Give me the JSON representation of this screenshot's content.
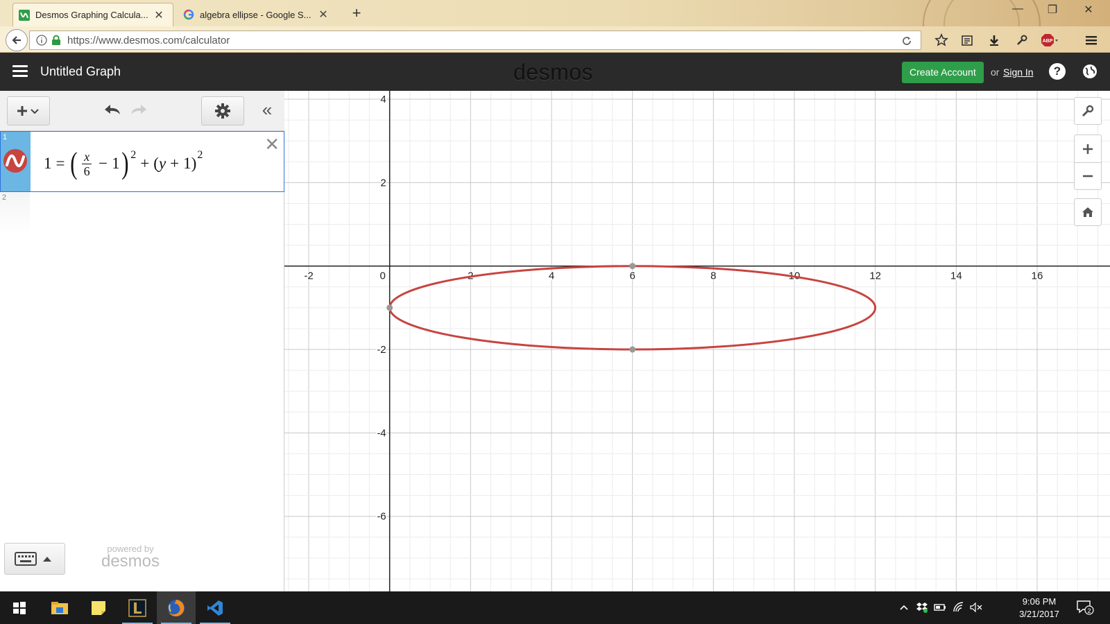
{
  "browser": {
    "tabs": [
      {
        "title": "Desmos Graphing Calcula...",
        "active": true,
        "favicon": "desmos-favicon"
      },
      {
        "title": "algebra ellipse - Google S...",
        "active": false,
        "favicon": "google-favicon"
      }
    ],
    "url": "https://www.desmos.com/calculator"
  },
  "desmos": {
    "graph_title": "Untitled Graph",
    "brand": "desmos",
    "create_account": "Create Account",
    "or_text": "or",
    "sign_in": "Sign In",
    "help_icon": "?",
    "expressions": [
      {
        "index": "1",
        "lhs": "1",
        "eq": "=",
        "frac_num": "x",
        "frac_den": "6",
        "minus": "−",
        "one_a": "1",
        "sq1": "2",
        "plus": "+",
        "y": "y",
        "plus2": "+",
        "one_b": "1",
        "sq2": "2",
        "color": "#c74440"
      },
      {
        "index": "2"
      }
    ],
    "powered_by": "powered by",
    "powered_brand": "desmos"
  },
  "graph": {
    "x_ticks": [
      "-2",
      "0",
      "2",
      "4",
      "6",
      "8",
      "10",
      "12",
      "14",
      "16"
    ],
    "y_ticks": [
      "4",
      "2",
      "-2",
      "-4",
      "-6"
    ],
    "xlim": [
      -2.6,
      17.8
    ],
    "ylim": [
      -7.8,
      4.2
    ],
    "ellipse": {
      "h": 6,
      "k": -1,
      "a": 6,
      "b": 1,
      "color": "#c74440"
    },
    "points": [
      [
        0,
        -1
      ],
      [
        6,
        0
      ],
      [
        6,
        -2
      ]
    ],
    "point_color": "#999999"
  },
  "taskbar": {
    "time": "9:06 PM",
    "date": "3/21/2017",
    "notifications": "2"
  }
}
